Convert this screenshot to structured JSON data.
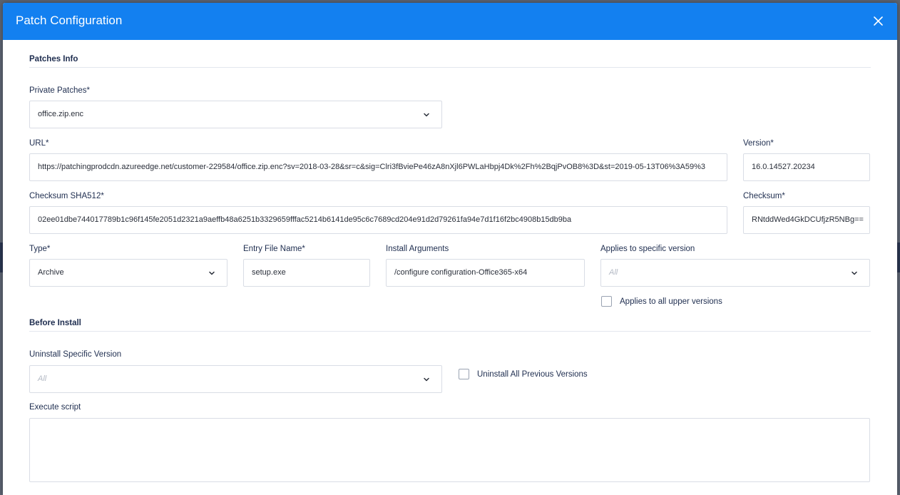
{
  "modal": {
    "title": "Patch Configuration",
    "close_icon": "close-icon"
  },
  "sections": {
    "patches_info": "Patches Info",
    "before_install": "Before Install"
  },
  "private_patches": {
    "label": "Private Patches*",
    "value": "office.zip.enc"
  },
  "url": {
    "label": "URL*",
    "value": "https://patchingprodcdn.azureedge.net/customer-229584/office.zip.enc?sv=2018-03-28&sr=c&sig=Clri3fBviePe46zA8nXjl6PWLaHbpj4Dk%2Fh%2BqjPvOB8%3D&st=2019-05-13T06%3A59%3"
  },
  "version": {
    "label": "Version*",
    "value": "16.0.14527.20234"
  },
  "checksum_sha512": {
    "label": "Checksum SHA512*",
    "value": "02ee01dbe744017789b1c96f145fe2051d2321a9aeffb48a6251b3329659fffac5214b6141de95c6c7689cd204e91d2d79261fa94e7d1f16f2bc4908b15db9ba"
  },
  "checksum": {
    "label": "Checksum*",
    "value": "RNtddWed4GkDCUfjzR5NBg=="
  },
  "type": {
    "label": "Type*",
    "value": "Archive"
  },
  "entry_file_name": {
    "label": "Entry File Name*",
    "value": "setup.exe"
  },
  "install_arguments": {
    "label": "Install Arguments",
    "value": "/configure configuration-Office365-x64"
  },
  "applies_to_specific_version": {
    "label": "Applies to specific version",
    "placeholder": "All"
  },
  "applies_to_all_upper": {
    "label": "Applies to all upper versions",
    "checked": false
  },
  "uninstall_specific_version": {
    "label": "Uninstall Specific Version",
    "placeholder": "All"
  },
  "uninstall_all_previous": {
    "label": "Uninstall All Previous Versions",
    "checked": false
  },
  "execute_script": {
    "label": "Execute script",
    "value": ""
  },
  "colors": {
    "header": "#1380f0",
    "label_text": "#1e2d4f",
    "border": "#d9dde5"
  }
}
